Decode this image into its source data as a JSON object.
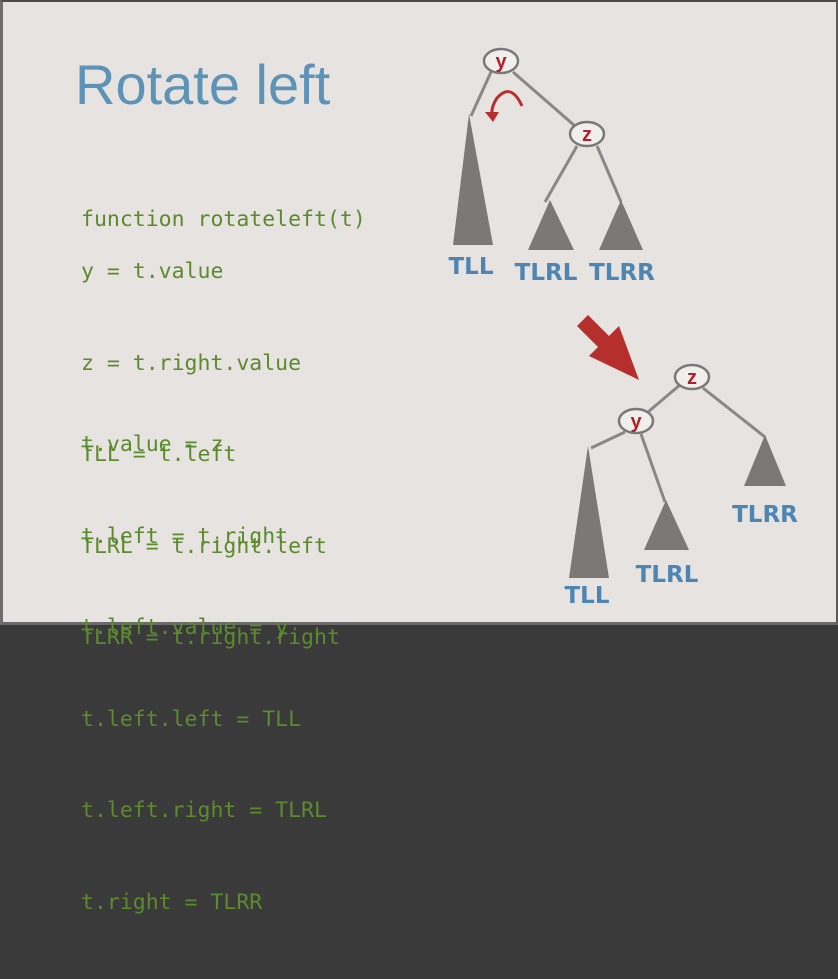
{
  "slide": {
    "title": "Rotate left",
    "code_signature": "function rotateleft(t)",
    "code_block_1": [
      "y = t.value",
      "z = t.right.value",
      "TLL = t.left",
      "TLRL = t.right.left",
      "TLRR = t.right.right"
    ],
    "code_block_2": [
      "t.value = z",
      "t.left = t.right",
      "t.left.value = y",
      "t.left.left = TLL",
      "t.left.right = TLRL",
      "t.right = TLRR"
    ]
  },
  "diagram_before": {
    "root_label": "y",
    "child_label": "z",
    "subtrees": [
      "TLL",
      "TLRL",
      "TLRR"
    ]
  },
  "diagram_after": {
    "root_label": "z",
    "child_label": "y",
    "subtrees": [
      "TLL",
      "TLRL",
      "TLRR"
    ]
  },
  "colors": {
    "title": "#5e93b8",
    "code": "#5c8a2e",
    "node_label": "#b0212b",
    "tree_label": "#4d85b3",
    "arrow": "#b5302c",
    "subtree_fill": "#7b7876",
    "edge": "#8a8886"
  }
}
